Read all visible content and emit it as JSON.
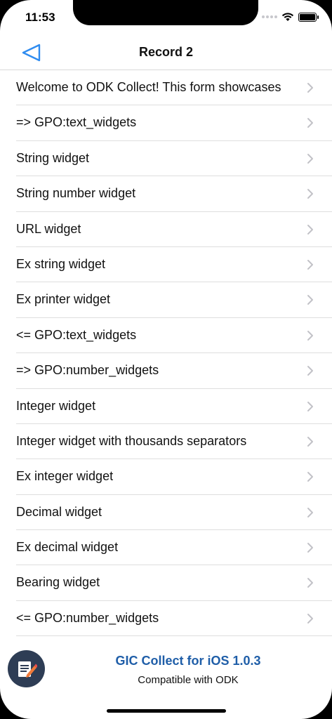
{
  "status_bar": {
    "time": "11:53"
  },
  "navbar": {
    "title": "Record 2"
  },
  "rows": [
    {
      "label": "Welcome to ODK Collect! This form showcases"
    },
    {
      "label": "=> GPO:text_widgets"
    },
    {
      "label": "String widget"
    },
    {
      "label": "String number widget"
    },
    {
      "label": "URL widget"
    },
    {
      "label": "Ex string widget"
    },
    {
      "label": "Ex printer widget"
    },
    {
      "label": "<= GPO:text_widgets"
    },
    {
      "label": "=> GPO:number_widgets"
    },
    {
      "label": "Integer widget"
    },
    {
      "label": "Integer widget with thousands separators"
    },
    {
      "label": "Ex integer widget"
    },
    {
      "label": "Decimal widget"
    },
    {
      "label": "Ex decimal widget"
    },
    {
      "label": "Bearing widget"
    },
    {
      "label": "<= GPO:number_widgets"
    }
  ],
  "footer": {
    "title": "GIC Collect for iOS 1.0.3",
    "subtitle": "Compatible with ODK"
  },
  "colors": {
    "accent": "#2f8cf0",
    "footer_title": "#1f5ea8",
    "app_icon_bg": "#2e3d55",
    "chevron": "#c2c2c7"
  },
  "icons": {
    "back": "back-triangle-icon",
    "row_disclosure": "chevron-right-icon",
    "app": "form-edit-icon"
  }
}
